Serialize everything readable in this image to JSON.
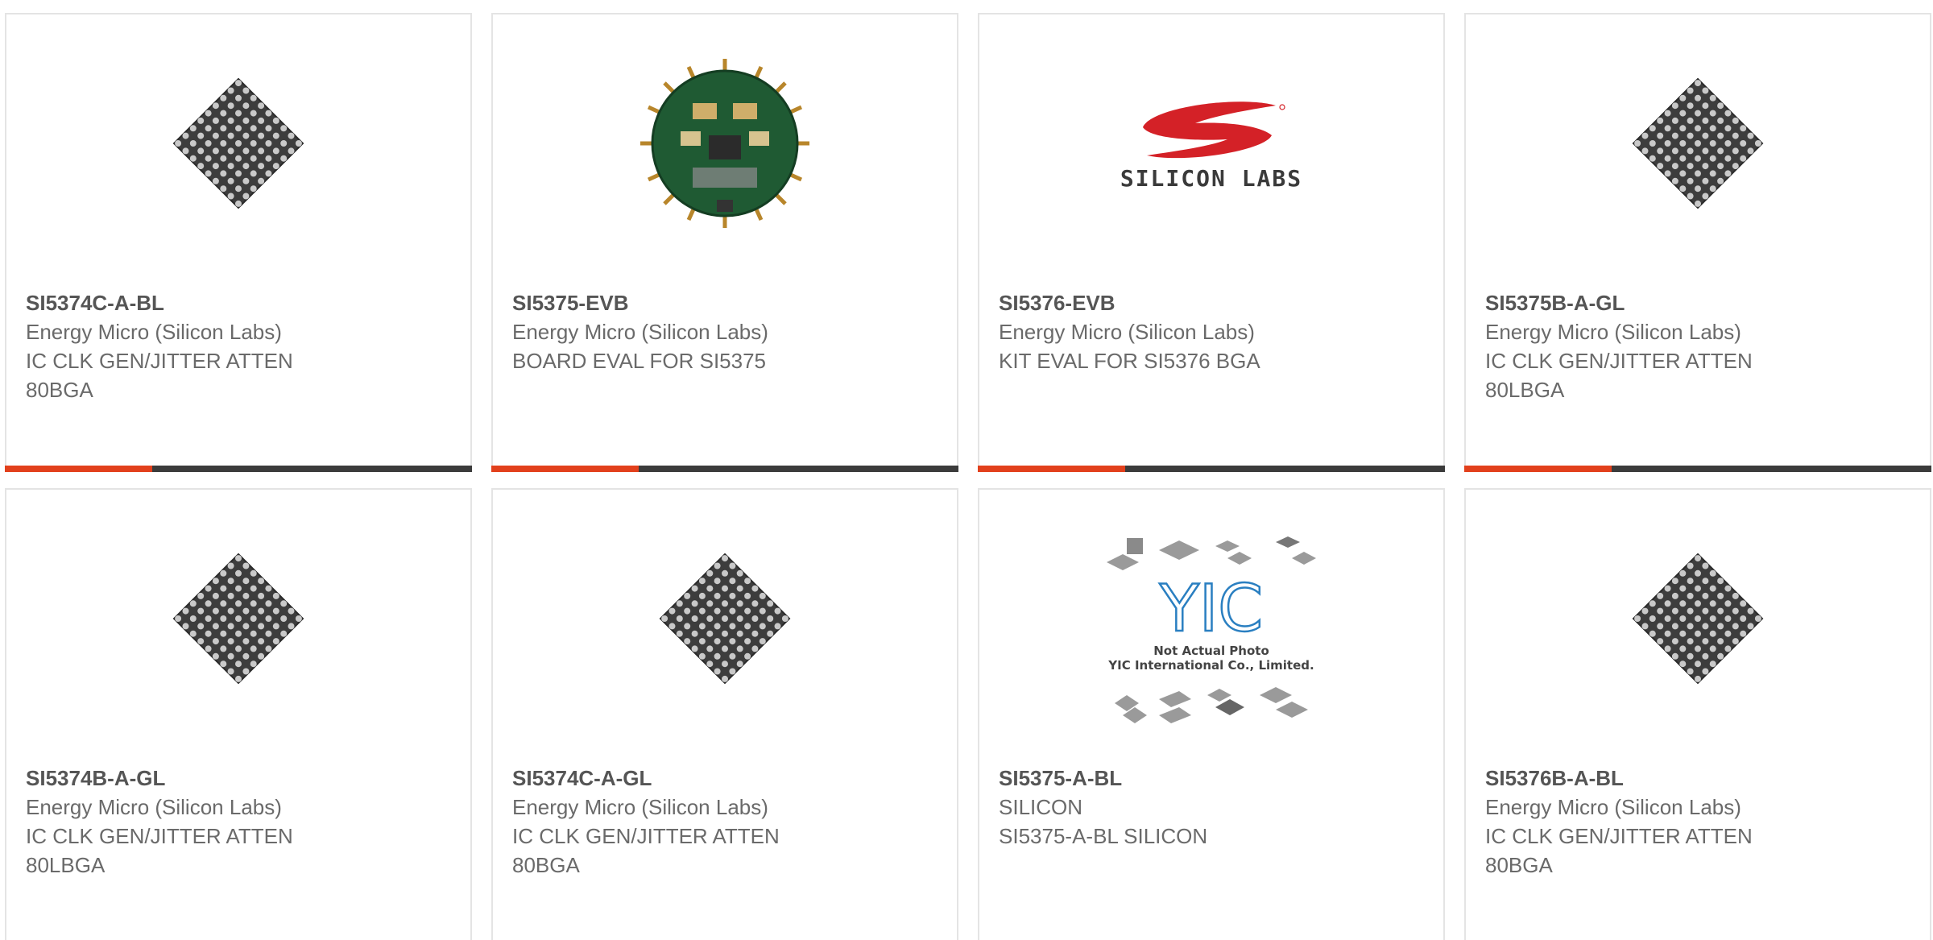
{
  "colors": {
    "accent": "#e2401c",
    "bar": "#3b3b3b",
    "border": "#e4e4e4",
    "part_number": "#555555",
    "text": "#6a6a6a"
  },
  "cards": [
    {
      "part": "SI5374C-A-BL",
      "mfr": "Energy Micro (Silicon Labs)",
      "desc": "IC CLK GEN/JITTER ATTEN 80BGA",
      "image": "bga-chip-icon"
    },
    {
      "part": "SI5375-EVB",
      "mfr": "Energy Micro (Silicon Labs)",
      "desc": "BOARD EVAL FOR SI5375",
      "image": "eval-board-icon"
    },
    {
      "part": "SI5376-EVB",
      "mfr": "Energy Micro (Silicon Labs)",
      "desc": "KIT EVAL FOR SI5376 BGA",
      "image": "silicon-labs-logo",
      "logo_text": "SILICON LABS"
    },
    {
      "part": "SI5375B-A-GL",
      "mfr": "Energy Micro (Silicon Labs)",
      "desc": "IC CLK GEN/JITTER ATTEN 80LBGA",
      "image": "bga-chip-icon"
    },
    {
      "part": "SI5374B-A-GL",
      "mfr": "Energy Micro (Silicon Labs)",
      "desc": "IC CLK GEN/JITTER ATTEN 80LBGA",
      "image": "bga-chip-icon"
    },
    {
      "part": "SI5374C-A-GL",
      "mfr": "Energy Micro (Silicon Labs)",
      "desc": "IC CLK GEN/JITTER ATTEN 80BGA",
      "image": "bga-chip-icon"
    },
    {
      "part": "SI5375-A-BL",
      "mfr": "SILICON",
      "desc": "SI5375-A-BL SILICON",
      "image": "yic-placeholder",
      "logo_text": "YIC",
      "photo_note": "Not Actual Photo",
      "photo_company": "YIC International Co., Limited."
    },
    {
      "part": "SI5376B-A-BL",
      "mfr": "Energy Micro (Silicon Labs)",
      "desc": "IC CLK GEN/JITTER ATTEN 80BGA",
      "image": "bga-chip-icon"
    }
  ]
}
